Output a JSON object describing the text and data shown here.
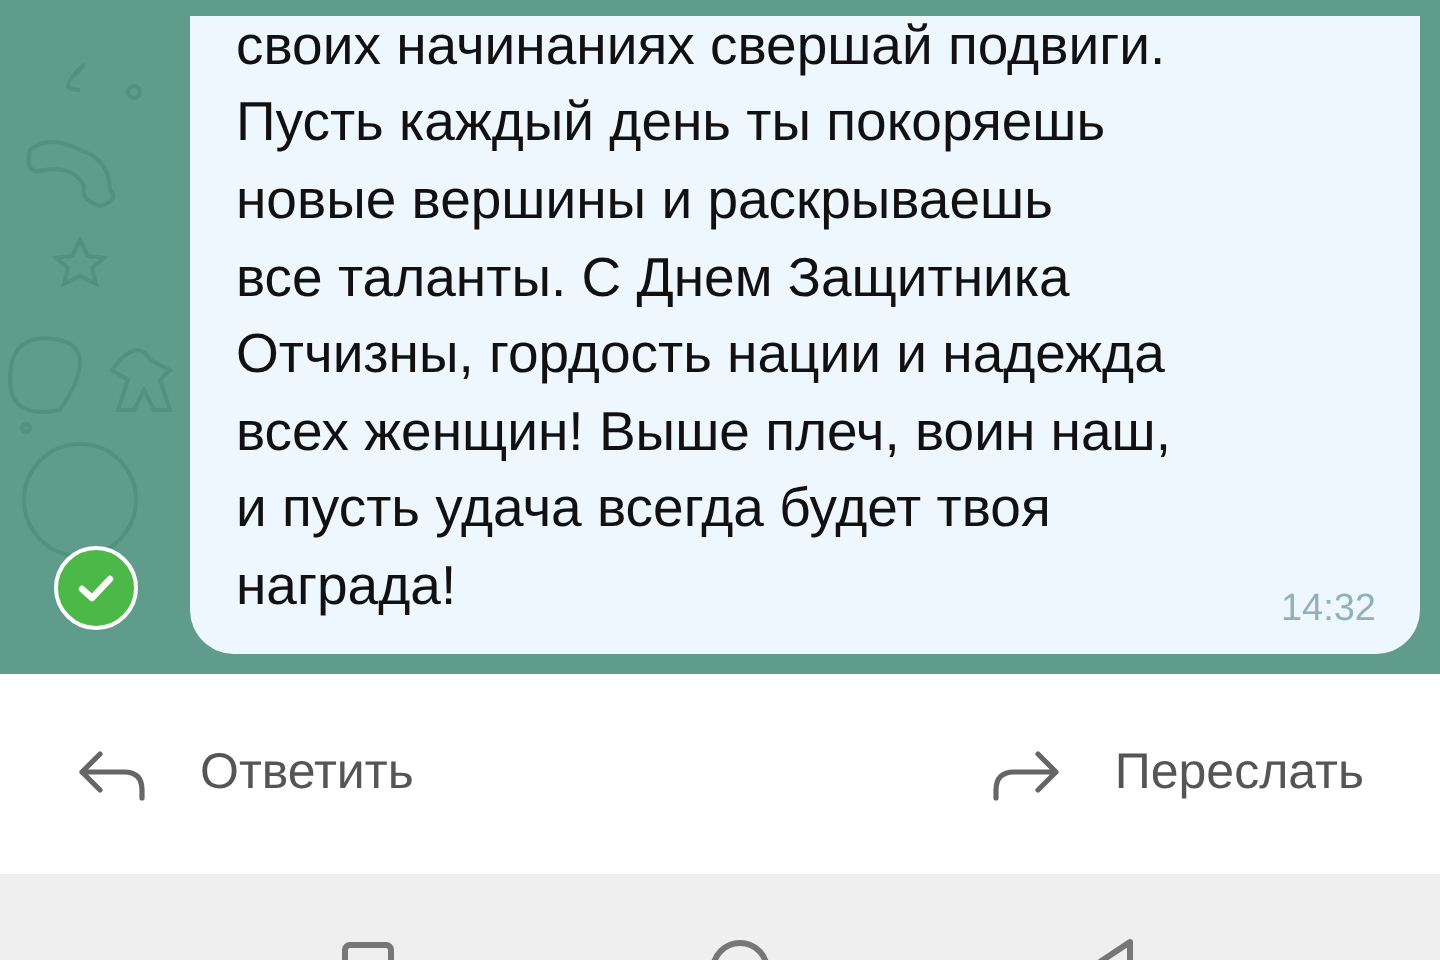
{
  "message": {
    "text": "своих начинаниях свершай подвиги.\nПусть каждый день ты покоряешь\nновые вершины и раскрываешь\nвсе таланты. С Днем Защитника\nОтчизны, гордость нации и надежда\nвсех женщин! Выше плеч, воин наш,\nи пусть удача всегда будет твоя\nнаграда!",
    "time": "14:32",
    "selected": true
  },
  "actions": [
    {
      "kind": "reply",
      "label": "Ответить"
    },
    {
      "kind": "forward",
      "label": "Переслать"
    }
  ]
}
